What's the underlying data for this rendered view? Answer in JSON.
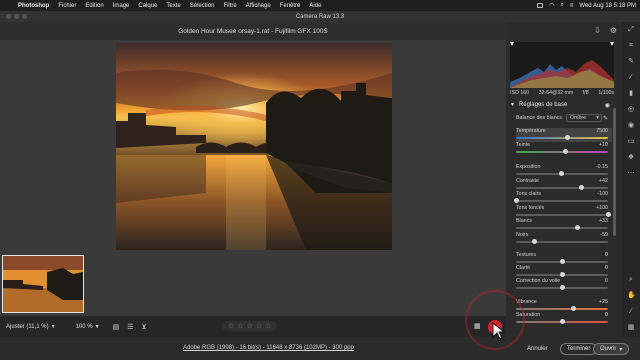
{
  "menubar": {
    "app": "Photoshop",
    "items": [
      "Fichier",
      "Edition",
      "Image",
      "Calque",
      "Texte",
      "Sélection",
      "Filtre",
      "Affichage",
      "Fenêtre",
      "Aide"
    ],
    "clock": "Wed Aug 18  5:18 PM"
  },
  "window": {
    "title": "Camera Raw 13.3",
    "file": "Golden Hour Musee orsay-1.raf  -  Fujifilm GFX 100S"
  },
  "exif": {
    "iso": "ISO 160",
    "lens": "32-64@32 mm",
    "aperture": "f/8",
    "shutter": "1/100s"
  },
  "panel": {
    "section": "Réglages de base",
    "wb_label": "Balance des blancs",
    "wb_value": "Ombre",
    "sliders": [
      {
        "label": "Température",
        "value": "7500",
        "level": 0.55
      },
      {
        "label": "Teinte",
        "value": "+10",
        "level": 0.53
      },
      {
        "label": "Exposition",
        "value": "-0.15",
        "level": 0.49
      },
      {
        "label": "Contraste",
        "value": "+42",
        "level": 0.71
      },
      {
        "label": "Tons clairs",
        "value": "-100",
        "level": 0.0
      },
      {
        "label": "Tons foncés",
        "value": "+100",
        "level": 1.0
      },
      {
        "label": "Blancs",
        "value": "+33",
        "level": 0.66
      },
      {
        "label": "Noirs",
        "value": "-59",
        "level": 0.2
      },
      {
        "label": "Textures",
        "value": "0",
        "level": 0.5
      },
      {
        "label": "Clarté",
        "value": "0",
        "level": 0.5
      },
      {
        "label": "Correction du voile",
        "value": "0",
        "level": 0.5
      },
      {
        "label": "Vibrance",
        "value": "+25",
        "level": 0.62
      },
      {
        "label": "Saturation",
        "value": "0",
        "level": 0.5
      }
    ]
  },
  "bottom": {
    "fit": "Ajuster (11,1 %)",
    "zoom": "100 %",
    "stars": [
      "☆",
      "☆",
      "☆",
      "☆",
      "☆"
    ]
  },
  "status": {
    "info": "Adobe RGB (1998) - 16 bit(s) - 11648 x 8736 (102MP) - 300 ppp",
    "cancel": "Annuler",
    "done": "Terminer",
    "open": "Ouvrir"
  },
  "colors": {
    "accent": "#e8a64a",
    "cursor": "#d4232f"
  }
}
